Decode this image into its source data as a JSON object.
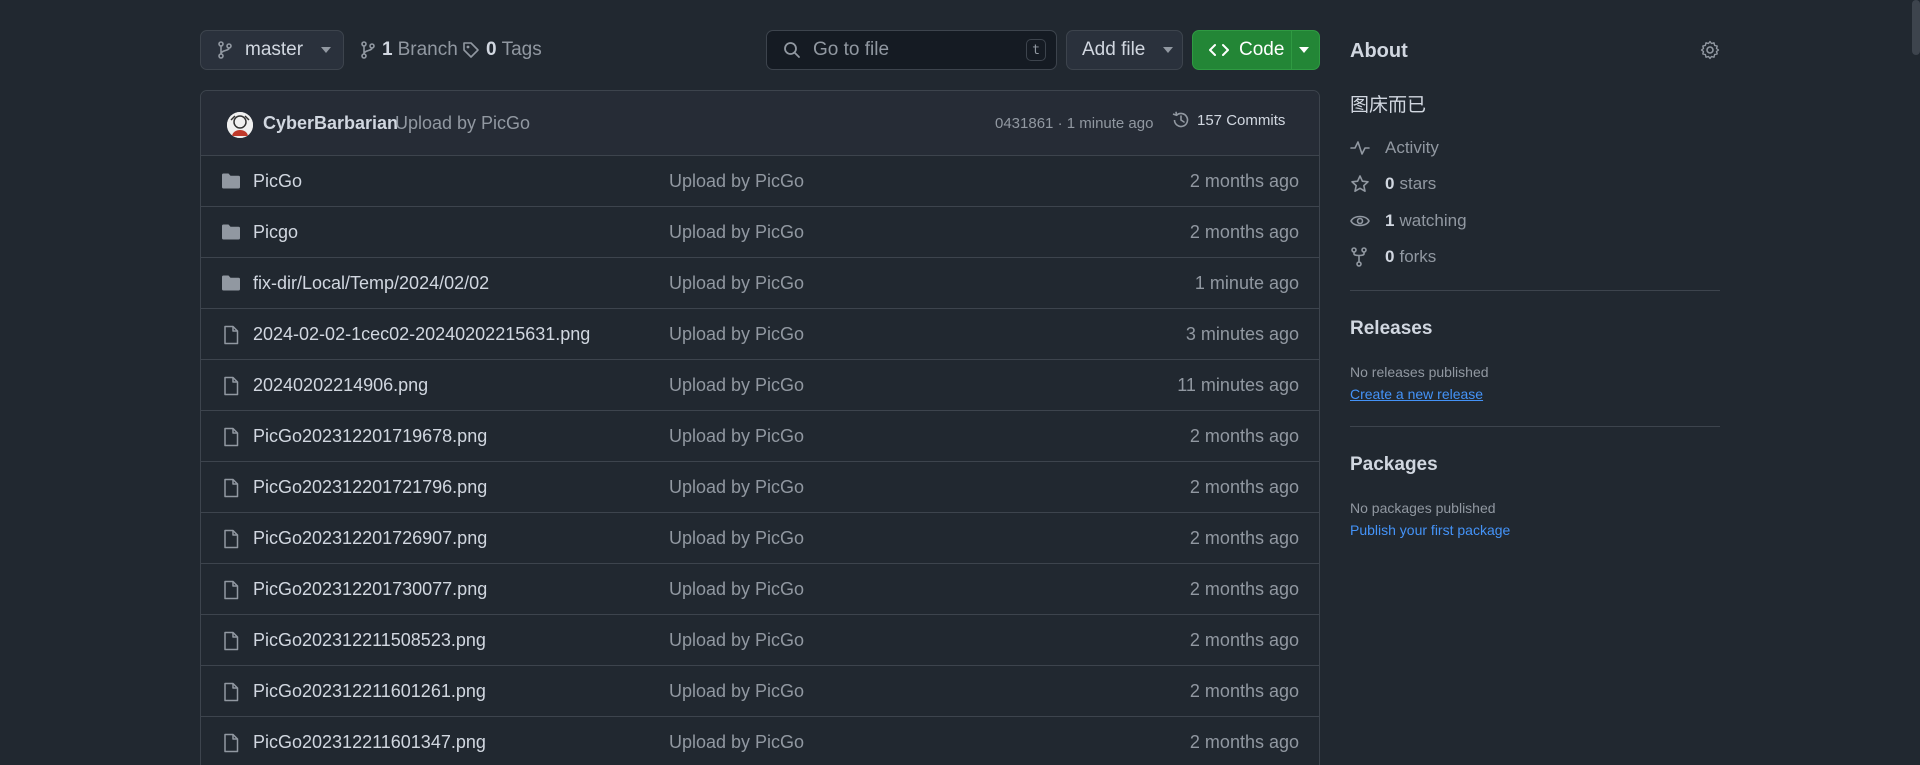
{
  "toolbar": {
    "branch": "master",
    "branch_count": "1",
    "branch_label": "Branch",
    "tag_count": "0",
    "tag_label": "Tags",
    "search_placeholder": "Go to file",
    "search_shortcut": "t",
    "add_file": "Add file",
    "code": "Code"
  },
  "commit": {
    "author": "CyberBarbarian",
    "message": "Upload by PicGo",
    "sha_time": "0431861 · 1 minute ago",
    "commits": "157 Commits"
  },
  "files": [
    {
      "type": "folder",
      "name": "PicGo",
      "message": "Upload by PicGo",
      "date": "2 months ago"
    },
    {
      "type": "folder",
      "name": "Picgo",
      "message": "Upload by PicGo",
      "date": "2 months ago"
    },
    {
      "type": "folder",
      "name": "fix-dir/Local/Temp/2024/02/02",
      "message": "Upload by PicGo",
      "date": "1 minute ago"
    },
    {
      "type": "file",
      "name": "2024-02-02-1cec02-20240202215631.png",
      "message": "Upload by PicGo",
      "date": "3 minutes ago"
    },
    {
      "type": "file",
      "name": "20240202214906.png",
      "message": "Upload by PicGo",
      "date": "11 minutes ago"
    },
    {
      "type": "file",
      "name": "PicGo202312201719678.png",
      "message": "Upload by PicGo",
      "date": "2 months ago"
    },
    {
      "type": "file",
      "name": "PicGo202312201721796.png",
      "message": "Upload by PicGo",
      "date": "2 months ago"
    },
    {
      "type": "file",
      "name": "PicGo202312201726907.png",
      "message": "Upload by PicGo",
      "date": "2 months ago"
    },
    {
      "type": "file",
      "name": "PicGo202312201730077.png",
      "message": "Upload by PicGo",
      "date": "2 months ago"
    },
    {
      "type": "file",
      "name": "PicGo202312211508523.png",
      "message": "Upload by PicGo",
      "date": "2 months ago"
    },
    {
      "type": "file",
      "name": "PicGo202312211601261.png",
      "message": "Upload by PicGo",
      "date": "2 months ago"
    },
    {
      "type": "file",
      "name": "PicGo202312211601347.png",
      "message": "Upload by PicGo",
      "date": "2 months ago"
    }
  ],
  "about": {
    "title": "About",
    "description": "图床而已",
    "activity": "Activity",
    "stars_count": "0",
    "stars_label": "stars",
    "watching_count": "1",
    "watching_label": "watching",
    "forks_count": "0",
    "forks_label": "forks"
  },
  "releases": {
    "title": "Releases",
    "empty": "No releases published",
    "link": "Create a new release"
  },
  "packages": {
    "title": "Packages",
    "empty": "No packages published",
    "link": "Publish your first package"
  },
  "colors": {
    "background": "#212830",
    "border": "#3d444d",
    "code_button": "#238636",
    "link": "#4493f8"
  }
}
